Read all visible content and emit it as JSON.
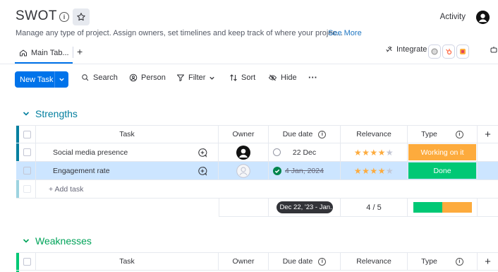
{
  "board": {
    "title": "SWOT",
    "description": "Manage any type of project. Assign owners, set timelines and keep track of where your projec...",
    "see_more": "See More",
    "activity": "Activity"
  },
  "tabs": {
    "main": "Main Tab...",
    "add": "+"
  },
  "integrate": {
    "label": "Integrate"
  },
  "toolbar": {
    "new_task": "New Task",
    "search": "Search",
    "person": "Person",
    "filter": "Filter",
    "sort": "Sort",
    "hide": "Hide",
    "more": "···"
  },
  "columns": {
    "task": "Task",
    "owner": "Owner",
    "due_date": "Due date",
    "relevance": "Relevance",
    "type": "Type",
    "add": "+"
  },
  "groups": [
    {
      "title": "Strengths",
      "color": "#037f9f",
      "rows": [
        {
          "task": "Social media presence",
          "due": "22 Dec",
          "done": false,
          "relevance": 4,
          "type": "Working on it",
          "type_color": "#fdab3d"
        },
        {
          "task": "Engagement rate",
          "due": "4 Jan, 2024",
          "done": true,
          "relevance": 4,
          "type": "Done",
          "type_color": "#00c875"
        }
      ],
      "add_task": "+ Add task",
      "summary": {
        "date_range": "Dec 22, '23 - Jan...",
        "relevance": "4 / 5",
        "type_split": [
          0.5,
          0.5
        ]
      }
    },
    {
      "title": "Weaknesses",
      "color": "#00c875"
    }
  ],
  "colors": {
    "accent": "#0073ea",
    "working": "#fdab3d",
    "done": "#00c875",
    "stars": "#fdab3d"
  }
}
